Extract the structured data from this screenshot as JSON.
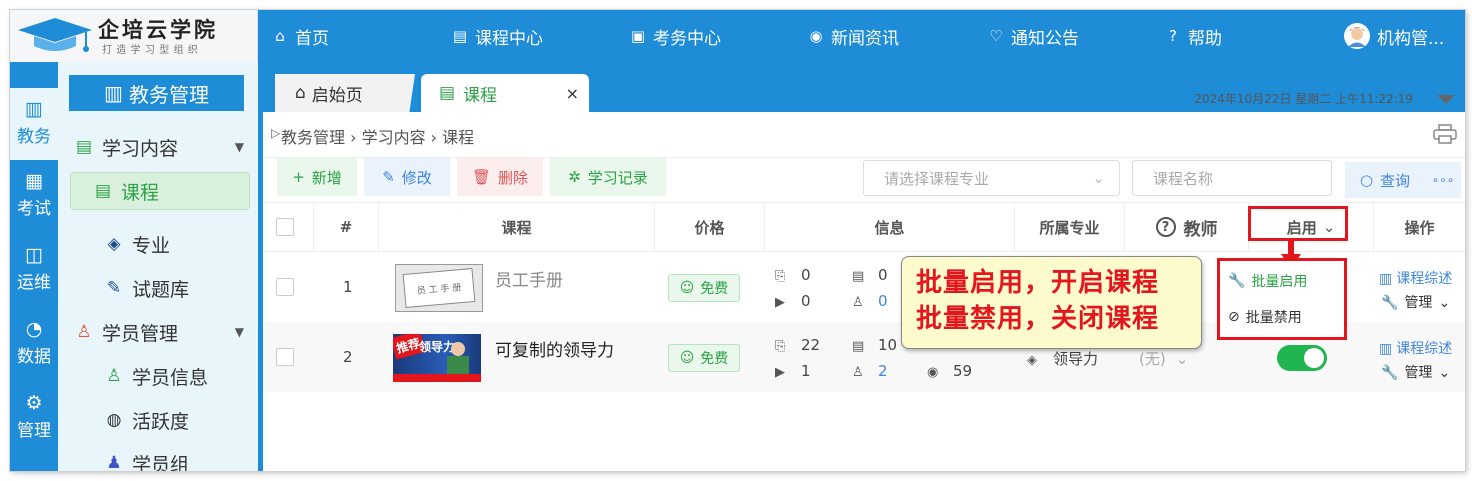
{
  "app": {
    "title": "企培云学院",
    "slogan": "打造学习型组织"
  },
  "topnav": [
    {
      "icon": "⌂",
      "label": "首页"
    },
    {
      "icon": "▤",
      "label": "课程中心"
    },
    {
      "icon": "▣",
      "label": "考务中心"
    },
    {
      "icon": "◉",
      "label": "新闻资讯"
    },
    {
      "icon": "♡",
      "label": "通知公告"
    },
    {
      "icon": "?",
      "label": "帮助"
    }
  ],
  "user": {
    "name": "机构管..."
  },
  "sidenav": [
    {
      "icon": "▥",
      "label": "教务"
    },
    {
      "icon": "▦",
      "label": "考试"
    },
    {
      "icon": "◫",
      "label": "运维"
    },
    {
      "icon": "◔",
      "label": "数据"
    },
    {
      "icon": "⚙",
      "label": "管理"
    }
  ],
  "sidebar": {
    "header": "教务管理",
    "items": [
      {
        "icon": "▤",
        "label": "学习内容"
      },
      {
        "icon": "▤",
        "label": "课程"
      },
      {
        "icon": "◈",
        "label": "专业"
      },
      {
        "icon": "✎",
        "label": "试题库"
      },
      {
        "icon": "♙",
        "label": "学员管理"
      },
      {
        "icon": "♙",
        "label": "学员信息"
      },
      {
        "icon": "◍",
        "label": "活跃度"
      },
      {
        "icon": "♟",
        "label": "学员组"
      }
    ]
  },
  "tabs": [
    {
      "icon": "⌂",
      "label": "启始页"
    },
    {
      "icon": "▤",
      "label": "课程",
      "close": "×"
    }
  ],
  "datetime": "2024年10月22日 星期二 上午11:22:19",
  "breadcrumb": "教务管理 › 学习内容 › 课程",
  "toolbar": {
    "add": "新增",
    "edit": "修改",
    "delete": "删除",
    "record": "学习记录",
    "major_placeholder": "请选择课程专业",
    "name_placeholder": "课程名称",
    "search": "查询",
    "more": "∘∘∘"
  },
  "table": {
    "headers": {
      "index": "#",
      "course": "课程",
      "price": "价格",
      "info": "信息",
      "major": "所属专业",
      "teacher": "教师",
      "enable": "启用",
      "action": "操作"
    },
    "rows": [
      {
        "index": "1",
        "title": "员工手册",
        "thumb_text": "员 工 手 册",
        "price": "免费",
        "docs": "0",
        "videos": "0",
        "q": "0",
        "students": "0",
        "report": "课程综述",
        "manage": "管理"
      },
      {
        "index": "2",
        "title": "可复制的领导力",
        "thumb_badge": "推荐",
        "thumb_text": "领导力",
        "price": "免费",
        "docs": "22",
        "videos": "1",
        "q": "10",
        "students": "2",
        "views": "59",
        "major": "领导力",
        "teacher": "(无)",
        "report": "课程综述",
        "manage": "管理"
      }
    ]
  },
  "dropdown": {
    "enable": "批量启用",
    "disable": "批量禁用"
  },
  "callout": {
    "line1": "批量启用，开启课程",
    "line2": "批量禁用，关闭课程"
  },
  "colors": {
    "primary": "#1e8cd6",
    "sidebar_bg": "#e8f6fb",
    "green": "#21b550",
    "red": "#e3161e"
  }
}
